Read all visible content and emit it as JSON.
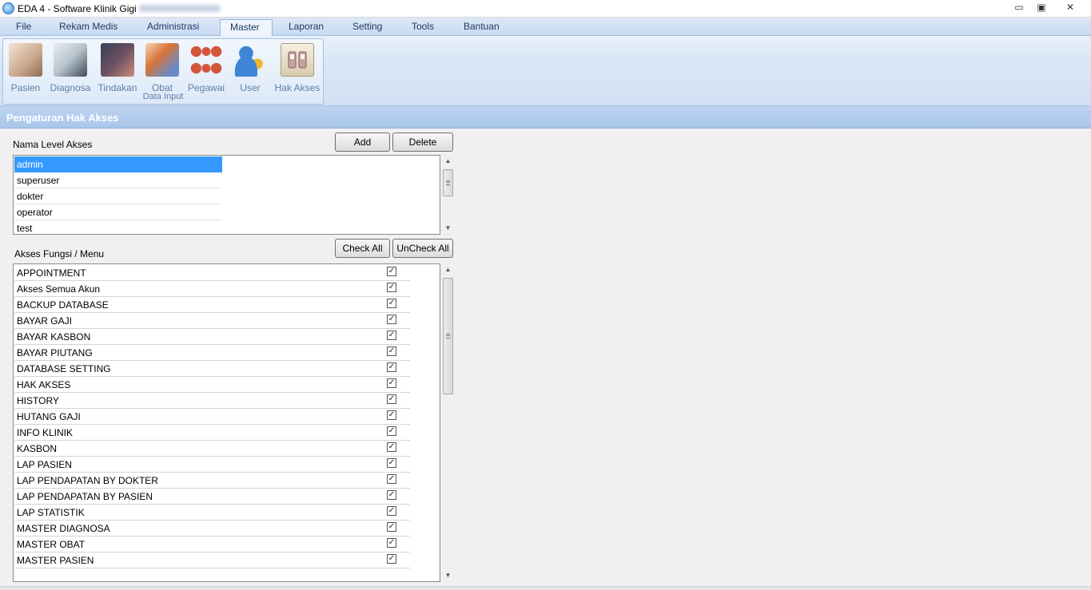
{
  "window": {
    "title": "EDA 4 - Software Klinik Gigi",
    "min_glyph": "▭",
    "max_glyph": "▣",
    "close_glyph": "✕"
  },
  "menu": [
    "File",
    "Rekam Medis",
    "Administrasi",
    "Master",
    "Laporan",
    "Setting",
    "Tools",
    "Bantuan"
  ],
  "menu_active": "Master",
  "ribbon": {
    "group_label": "Data Input",
    "buttons": [
      {
        "label": "Pasien",
        "icon": "patient-icon"
      },
      {
        "label": "Diagnosa",
        "icon": "doctor-icon"
      },
      {
        "label": "Tindakan",
        "icon": "treatment-icon"
      },
      {
        "label": "Obat",
        "icon": "medicine-icon"
      },
      {
        "label": "Pegawai",
        "icon": "employees-icon"
      },
      {
        "label": "User",
        "icon": "user-key-icon"
      },
      {
        "label": "Hak Akses",
        "icon": "switch-icon"
      }
    ]
  },
  "section": {
    "title": "Pengaturan Hak Akses"
  },
  "level": {
    "label": "Nama Level Akses",
    "add_label": "Add",
    "delete_label": "Delete",
    "items": [
      "admin",
      "superuser",
      "dokter",
      "operator",
      "test"
    ],
    "selected": "admin"
  },
  "access": {
    "label": "Akses Fungsi / Menu",
    "check_all_label": "Check All",
    "uncheck_all_label": "UnCheck All",
    "checkmark": "✓",
    "items": [
      {
        "name": "APPOINTMENT",
        "checked": true
      },
      {
        "name": "Akses Semua Akun",
        "checked": true
      },
      {
        "name": "BACKUP DATABASE",
        "checked": true
      },
      {
        "name": "BAYAR GAJI",
        "checked": true
      },
      {
        "name": "BAYAR KASBON",
        "checked": true
      },
      {
        "name": "BAYAR PIUTANG",
        "checked": true
      },
      {
        "name": "DATABASE SETTING",
        "checked": true
      },
      {
        "name": "HAK AKSES",
        "checked": true
      },
      {
        "name": "HISTORY",
        "checked": true
      },
      {
        "name": "HUTANG GAJI",
        "checked": true
      },
      {
        "name": "INFO KLINIK",
        "checked": true
      },
      {
        "name": "KASBON",
        "checked": true
      },
      {
        "name": "LAP PASIEN",
        "checked": true
      },
      {
        "name": "LAP PENDAPATAN BY DOKTER",
        "checked": true
      },
      {
        "name": "LAP PENDAPATAN BY PASIEN",
        "checked": true
      },
      {
        "name": "LAP STATISTIK",
        "checked": true
      },
      {
        "name": "MASTER DIAGNOSA",
        "checked": true
      },
      {
        "name": "MASTER OBAT",
        "checked": true
      },
      {
        "name": "MASTER PASIEN",
        "checked": true
      }
    ]
  },
  "scroll": {
    "up_glyph": "▲",
    "down_glyph": "▼"
  }
}
